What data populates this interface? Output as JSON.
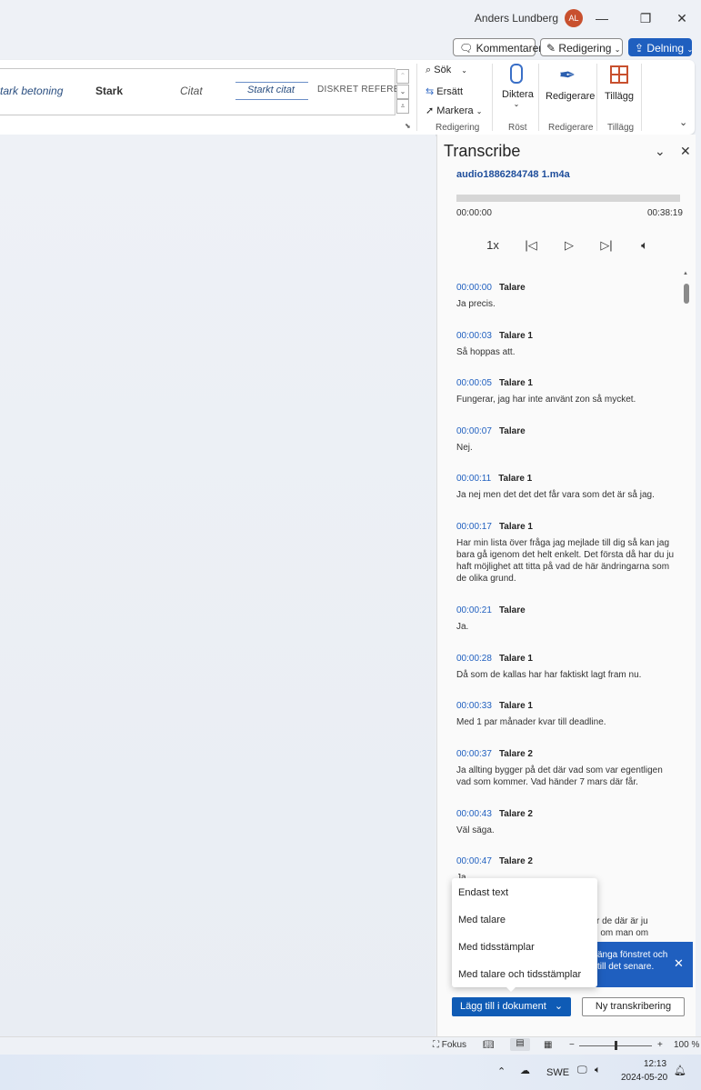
{
  "titlebar": {
    "user_name": "Anders Lundberg",
    "avatar_initials": "AL",
    "minimize": "—",
    "restore": "❐",
    "close": "✕"
  },
  "commands": {
    "comments": "Kommentarer",
    "editing": "Redigering",
    "share": "Delning"
  },
  "ribbon": {
    "styles": [
      "tark betoning",
      "Stark",
      "Citat",
      "Starkt citat",
      "DISKRET REFEREN"
    ],
    "search": "Sök",
    "replace": "Ersätt",
    "select": "Markera",
    "group_editing": "Redigering",
    "dictate": "Diktera",
    "group_voice": "Röst",
    "editor": "Redigerare",
    "group_editor": "Redigerare",
    "addins": "Tillägg",
    "group_addins": "Tillägg"
  },
  "pane": {
    "title": "Transcribe",
    "file_name": "audio1886284748 1.m4a",
    "time_start": "00:00:00",
    "time_end": "00:38:19",
    "progress": 0.0,
    "speed": "1x"
  },
  "transcript": [
    {
      "time": "00:00:00",
      "speaker": "Talare",
      "text": "Ja precis."
    },
    {
      "time": "00:00:03",
      "speaker": "Talare 1",
      "text": "Så hoppas att."
    },
    {
      "time": "00:00:05",
      "speaker": "Talare 1",
      "text": "Fungerar, jag har inte använt zon så mycket."
    },
    {
      "time": "00:00:07",
      "speaker": "Talare",
      "text": "Nej."
    },
    {
      "time": "00:00:11",
      "speaker": "Talare 1",
      "text": "Ja nej men det det det får vara som det är så jag."
    },
    {
      "time": "00:00:17",
      "speaker": "Talare 1",
      "text": "Har min lista över fråga jag mejlade till dig så kan jag bara gå igenom det helt enkelt. Det första då har du ju haft möjlighet att titta på vad de här ändringarna som de olika grund."
    },
    {
      "time": "00:00:21",
      "speaker": "Talare",
      "text": "Ja."
    },
    {
      "time": "00:00:28",
      "speaker": "Talare 1",
      "text": "Då som de kallas har har faktiskt lagt fram nu."
    },
    {
      "time": "00:00:33",
      "speaker": "Talare 1",
      "text": "Med 1 par månader kvar till deadline."
    },
    {
      "time": "00:00:37",
      "speaker": "Talare 2",
      "text": "Ja allting bygger på det där vad som var egentligen vad som kommer. Vad händer 7 mars där får."
    },
    {
      "time": "00:00:43",
      "speaker": "Talare 2",
      "text": "Väl säga."
    },
    {
      "time": "00:00:47",
      "speaker": "Talare 2",
      "text": "Ja."
    }
  ],
  "partial": {
    "line1": "r de där är ju",
    "line2": "n om man om"
  },
  "dropdown": {
    "items": [
      "Endast text",
      "Med talare",
      "Med tidsstämplar",
      "Med talare och tidsstämplar"
    ]
  },
  "notice": {
    "text": "änga fönstret och till det senare."
  },
  "buttons": {
    "add_to_doc": "Lägg till i dokument",
    "new_transcription": "Ny transkribering"
  },
  "statusbar": {
    "focus": "Fokus",
    "zoom": "100 %"
  },
  "taskbar": {
    "language": "SWE",
    "time": "12:13",
    "date": "2024-05-20"
  }
}
